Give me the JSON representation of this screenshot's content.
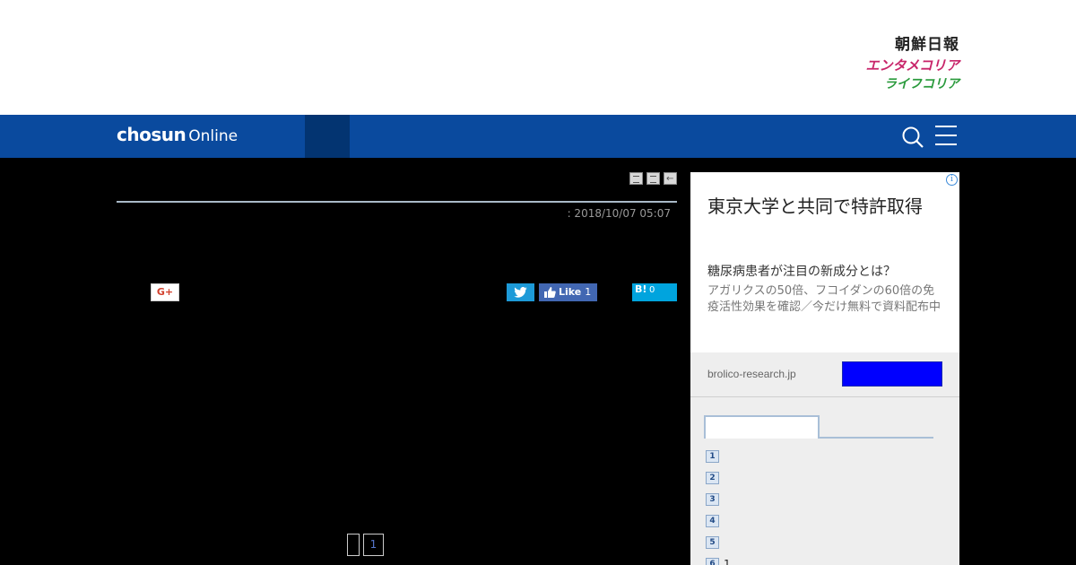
{
  "header": {
    "brand_links": [
      "朝鮮日報",
      "エンタメコリア",
      "ライフコリア"
    ]
  },
  "nav": {
    "logo_bold": "chosun",
    "logo_light": "Online",
    "icons": [
      "search-icon",
      "menu-icon"
    ],
    "colors": {
      "bar": "#0a4a9e",
      "active_block": "#033471"
    }
  },
  "article": {
    "date": ": 2018/10/07 05:07",
    "tools": [
      "print-icon",
      "font-size-icon",
      "back-icon"
    ]
  },
  "share": {
    "gplus_label": "G+",
    "facebook_label": "Like",
    "facebook_count": "1",
    "hatena_label": "B!",
    "hatena_count": "0"
  },
  "pager": {
    "current": "1"
  },
  "ad": {
    "info_glyph": "i",
    "title": "東京大学と共同で特許取得",
    "subtitle": "糖尿病患者が注目の新成分とは？",
    "description": "アガリクスの50倍、フコイダンの60倍の免疫活性効果を確認／今だけ無料で資料配布中",
    "domain": "brolico-research.jp",
    "button_color": "#0000ff"
  },
  "ranking": {
    "items": [
      {
        "num": "1",
        "text": ""
      },
      {
        "num": "2",
        "text": ""
      },
      {
        "num": "3",
        "text": ""
      },
      {
        "num": "4",
        "text": ""
      },
      {
        "num": "5",
        "text": ""
      },
      {
        "num": "6",
        "text": "1"
      }
    ]
  }
}
